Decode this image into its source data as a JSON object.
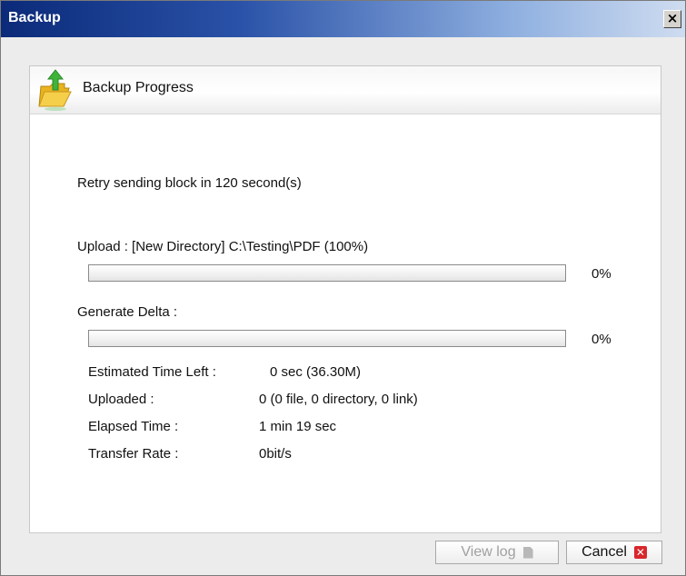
{
  "window": {
    "title": "Backup",
    "close_glyph": "×"
  },
  "header": {
    "title": "Backup Progress",
    "icon": "folder-upload-icon"
  },
  "status": {
    "message": "Retry sending block in 120 second(s)"
  },
  "upload": {
    "label": "Upload :  [New Directory] C:\\Testing\\PDF (100%)",
    "progress": 0,
    "percent_text": "0%"
  },
  "delta": {
    "label": "Generate Delta :",
    "progress": 0,
    "percent_text": "0%"
  },
  "stats": [
    {
      "label": "Estimated Time Left :",
      "value": "0 sec (36.30M)"
    },
    {
      "label": "Uploaded :",
      "value": "0 (0 file, 0 directory, 0 link)"
    },
    {
      "label": "Elapsed Time :",
      "value": "1 min 19 sec"
    },
    {
      "label": "Transfer Rate :",
      "value": "0bit/s"
    }
  ],
  "buttons": {
    "view_log": "View log",
    "cancel": "Cancel"
  },
  "colors": {
    "title_gradient_start": "#0b2a79",
    "cancel_icon": "#d9262c"
  }
}
